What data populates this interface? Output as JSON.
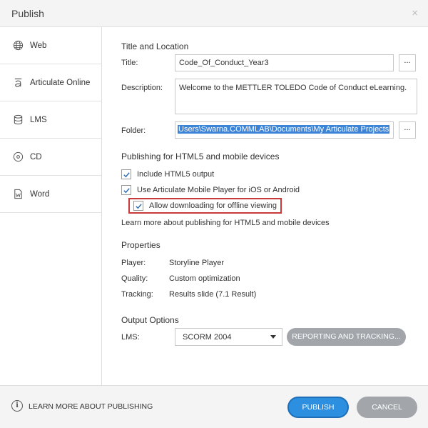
{
  "window": {
    "title": "Publish",
    "close_glyph": "×"
  },
  "sidebar": {
    "items": [
      {
        "label": "Web",
        "icon": "globe-icon"
      },
      {
        "label": "Articulate Online",
        "icon": "articulate-icon"
      },
      {
        "label": "LMS",
        "icon": "database-icon"
      },
      {
        "label": "CD",
        "icon": "disc-icon"
      },
      {
        "label": "Word",
        "icon": "word-document-icon"
      }
    ]
  },
  "title_location": {
    "heading": "Title and Location",
    "title_label": "Title:",
    "title_value": "Code_Of_Conduct_Year3",
    "description_label": "Description:",
    "description_value": "Welcome to the METTLER TOLEDO Code of Conduct eLearning.",
    "folder_label": "Folder:",
    "folder_value": "Users\\Swarna.COMMLAB\\Documents\\My Articulate Projects",
    "browse_label": "..."
  },
  "html5": {
    "heading": "Publishing for HTML5 and mobile devices",
    "include_html5": {
      "label": "Include HTML5 output",
      "checked": true
    },
    "mobile_player": {
      "label": "Use Articulate Mobile Player for iOS or Android",
      "checked": true
    },
    "offline": {
      "label": "Allow downloading for offline viewing",
      "checked": true
    },
    "learn_more": "Learn more about publishing for HTML5 and mobile devices"
  },
  "properties": {
    "heading": "Properties",
    "player_label": "Player:",
    "player_value": "Storyline Player",
    "quality_label": "Quality:",
    "quality_value": "Custom optimization",
    "tracking_label": "Tracking:",
    "tracking_value": "Results slide (7.1 Result)"
  },
  "output": {
    "heading": "Output Options",
    "lms_label": "LMS:",
    "lms_selected": "SCORM 2004",
    "reporting_button": "REPORTING AND TRACKING..."
  },
  "footer": {
    "learn_more": "LEARN MORE ABOUT PUBLISHING",
    "publish": "PUBLISH",
    "cancel": "CANCEL"
  },
  "colors": {
    "accent": "#2c8fe0",
    "selection": "#3d84d6",
    "highlight_border": "#c8393b",
    "gray_button": "#a2a6ab"
  }
}
